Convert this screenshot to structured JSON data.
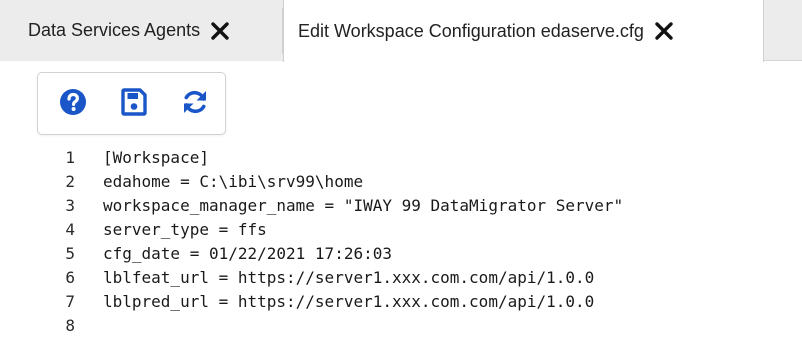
{
  "tabs": [
    {
      "label": "Data Services Agents",
      "active": false
    },
    {
      "label": "Edit Workspace Configuration edaserve.cfg",
      "active": true
    }
  ],
  "toolbar": {
    "buttons": [
      {
        "name": "help",
        "icon": "question-circle-icon"
      },
      {
        "name": "save",
        "icon": "floppy-disk-icon"
      },
      {
        "name": "refresh",
        "icon": "refresh-icon"
      }
    ]
  },
  "colors": {
    "icon_blue": "#1a56c8",
    "tabbar_bg": "#ececec",
    "active_tab_bg": "#ffffff"
  },
  "editor": {
    "lines": [
      {
        "number": "1",
        "text": "[Workspace]"
      },
      {
        "number": "2",
        "text": "edahome = C:\\ibi\\srv99\\home"
      },
      {
        "number": "3",
        "text": "workspace_manager_name = \"IWAY 99 DataMigrator Server\""
      },
      {
        "number": "4",
        "text": "server_type = ffs"
      },
      {
        "number": "5",
        "text": "cfg_date = 01/22/2021 17:26:03"
      },
      {
        "number": "6",
        "text": "lblfeat_url = https://server1.xxx.com.com/api/1.0.0"
      },
      {
        "number": "7",
        "text": "lblpred_url = https://server1.xxx.com.com/api/1.0.0"
      },
      {
        "number": "8",
        "text": ""
      }
    ]
  }
}
